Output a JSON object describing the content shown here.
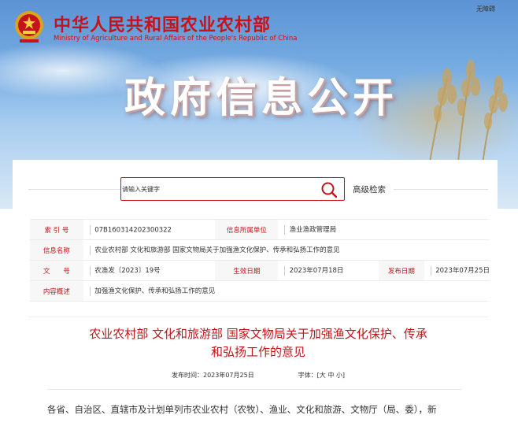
{
  "header": {
    "site_title": "中华人民共和国农业农村部",
    "site_subtitle": "Ministry of Agriculture and Rural Affairs of the People's Republic of China",
    "accessible_label": "无障碍",
    "section_title": "政府信息公开"
  },
  "search": {
    "placeholder": "请输入关键字",
    "advanced_label": "高级检索"
  },
  "meta": {
    "index_label": "索 引 号",
    "index_value": "07B160314202300322",
    "dept_label": "信息所属单位",
    "dept_value": "渔业渔政管理局",
    "title_label": "信息名称",
    "title_value": "农业农村部 文化和旅游部 国家文物局关于加强渔文化保护、传承和弘扬工作的意见",
    "doc_label": "文　　号",
    "doc_value": "农渔发〔2023〕19号",
    "effective_label": "生效日期",
    "effective_value": "2023年07月18日",
    "publish_label": "发布日期",
    "publish_value": "2023年07月25日",
    "summary_label": "内容概述",
    "summary_value": "加强渔文化保护、传承和弘扬工作的意见"
  },
  "article": {
    "title_line1": "农业农村部 文化和旅游部 国家文物局关于加强渔文化保护、传承",
    "title_line2": "和弘扬工作的意见",
    "publish_label": "发布时间：",
    "publish_value": "2023年07月25日",
    "font_label": "字体：",
    "font_open": "[",
    "font_large": "大",
    "font_medium": "中",
    "font_small": "小",
    "font_close": "]",
    "body_line1": "各省、自治区、直辖市及计划单列市农业农村（农牧）、渔业、文化和旅游、文物厅（局、委），新"
  },
  "colors": {
    "brand_red": "#c4141a"
  }
}
